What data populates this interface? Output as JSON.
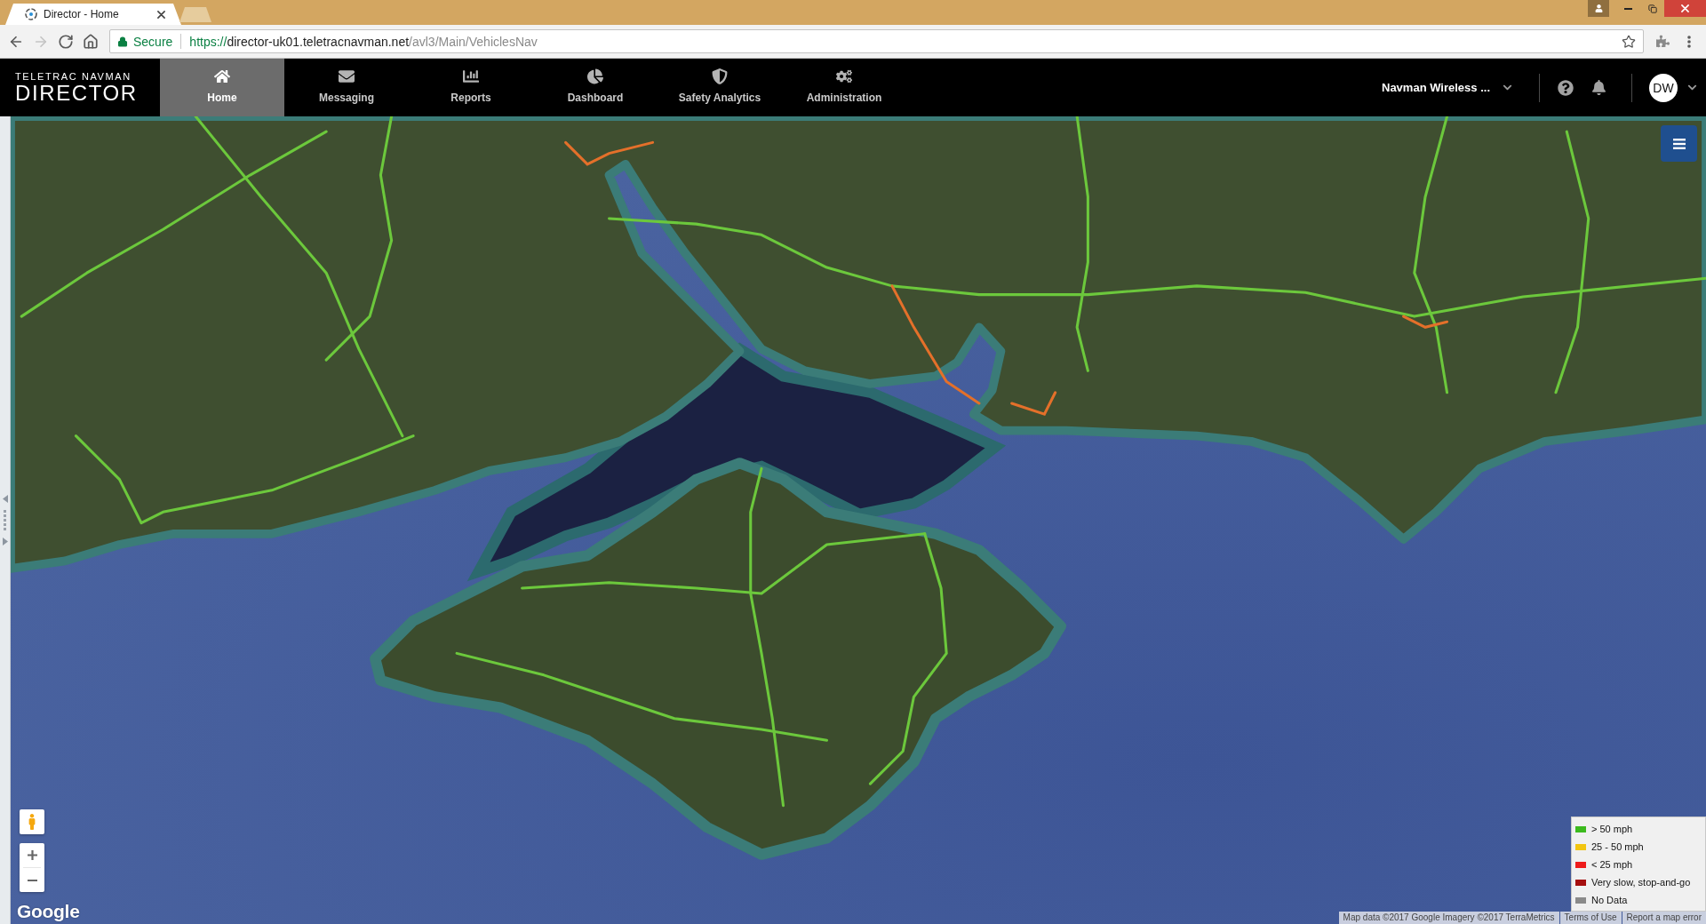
{
  "browser": {
    "tabs": [
      {
        "title": "Director - Home",
        "selected": true
      }
    ],
    "nav_buttons": [
      {
        "kind": "back",
        "disabled": false
      },
      {
        "kind": "forward",
        "disabled": true
      },
      {
        "kind": "reload",
        "disabled": false
      },
      {
        "kind": "home",
        "disabled": false
      }
    ],
    "address": {
      "security": "Secure",
      "scheme": "https://",
      "host": "director-uk01.teletracnavman.net",
      "path": "/avl3/Main/VehiclesNav"
    }
  },
  "app": {
    "logo": {
      "brand": "TELETRAC NAVMAN",
      "product": "DIRECTOR"
    },
    "nav": [
      {
        "label": "Home",
        "selected": true
      },
      {
        "label": "Messaging",
        "selected": false
      },
      {
        "label": "Reports",
        "selected": false
      },
      {
        "label": "Dashboard",
        "selected": false
      },
      {
        "label": "Safety Analytics",
        "selected": false
      },
      {
        "label": "Administration",
        "selected": false
      }
    ],
    "account": "Navman Wireless ...",
    "user_initials": "DW"
  },
  "map": {
    "legend": [
      {
        "label": "> 50 mph",
        "color": "#3cba1e"
      },
      {
        "label": "25 - 50 mph",
        "color": "#f2c511"
      },
      {
        "label": "< 25 mph",
        "color": "#ee1c1c"
      },
      {
        "label": "Very slow, stop-and-go",
        "color": "#a50f0f"
      },
      {
        "label": "No Data",
        "color": "#8a8a8a"
      }
    ],
    "google_logo": "Google",
    "attribution": {
      "data": "Map data ©2017 Google Imagery ©2017 TerraMetrics",
      "links": [
        "Terms of Use",
        "Report a map error"
      ]
    }
  }
}
